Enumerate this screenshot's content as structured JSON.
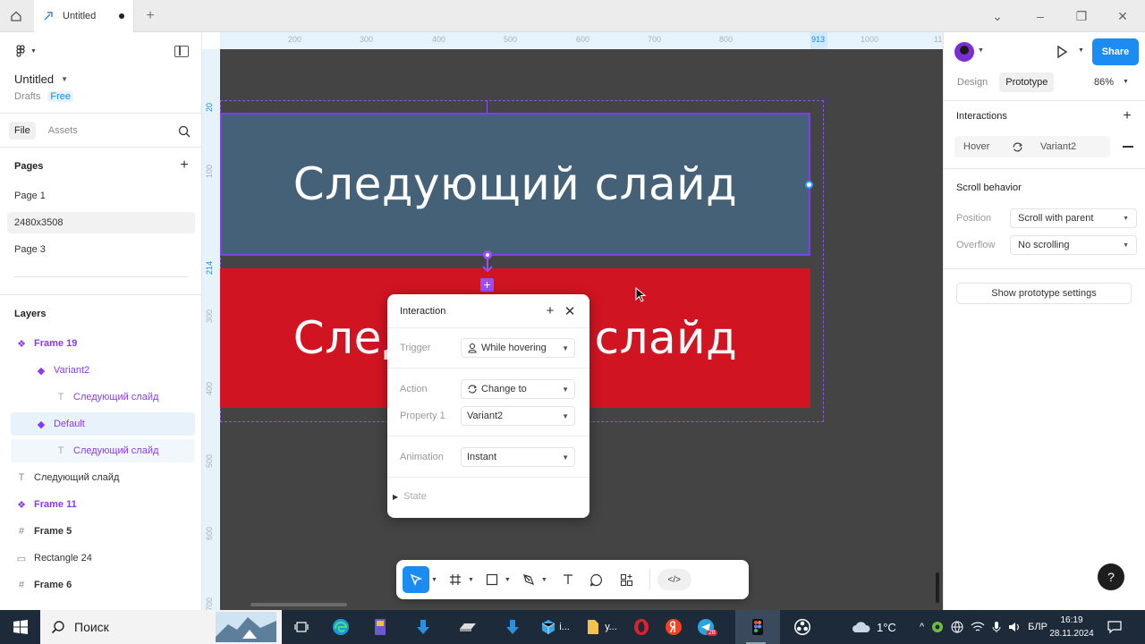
{
  "browser": {
    "tab_title": "Untitled",
    "new_tab_symbol": "+"
  },
  "left_panel": {
    "file_name": "Untitled",
    "location": "Drafts",
    "plan_badge": "Free",
    "tabs": [
      "File",
      "Assets"
    ],
    "pages_title": "Pages",
    "pages": [
      "Page 1",
      "2480x3508",
      "Page 3"
    ],
    "layers_title": "Layers",
    "layers": [
      {
        "label": "Frame 19",
        "icon": "component-set-icon"
      },
      {
        "label": "Variant2",
        "icon": "component-icon"
      },
      {
        "label": "Следующий слайд",
        "icon": "text-icon"
      },
      {
        "label": "Default",
        "icon": "component-icon"
      },
      {
        "label": "Следующий слайд",
        "icon": "text-icon"
      },
      {
        "label": "Следующий слайд",
        "icon": "text-icon"
      },
      {
        "label": "Frame 11",
        "icon": "component-set-icon"
      },
      {
        "label": "Frame 5",
        "icon": "frame-icon"
      },
      {
        "label": "Rectangle 24",
        "icon": "rectangle-icon"
      },
      {
        "label": "Frame 6",
        "icon": "frame-icon"
      }
    ]
  },
  "canvas": {
    "ruler_top": [
      "200",
      "300",
      "400",
      "500",
      "600",
      "700",
      "800",
      "913",
      "1000",
      "11"
    ],
    "ruler_left": [
      "20",
      "100",
      "214",
      "300",
      "400",
      "500",
      "600",
      "700"
    ],
    "slide_text_top": "Следующий слайд",
    "slide_text_bottom": "Следующий слайд",
    "top_button_color": "#456178",
    "bottom_button_color": "#d01422",
    "selection_color": "#7b3ff2"
  },
  "interaction_popup": {
    "title": "Interaction",
    "trigger_label": "Trigger",
    "trigger_value": "While hovering",
    "action_label": "Action",
    "action_value": "Change to",
    "property_label": "Property 1",
    "property_value": "Variant2",
    "animation_label": "Animation",
    "animation_value": "Instant",
    "state_label": "State"
  },
  "right_panel": {
    "share_label": "Share",
    "tabs": [
      "Design",
      "Prototype"
    ],
    "zoom": "86%",
    "interactions_title": "Interactions",
    "interaction_trigger": "Hover",
    "interaction_target": "Variant2",
    "scroll_title": "Scroll behavior",
    "position_label": "Position",
    "position_value": "Scroll with parent",
    "overflow_label": "Overflow",
    "overflow_value": "No scrolling",
    "prototype_settings_label": "Show prototype settings",
    "accent_color": "#1b8cf2"
  },
  "taskbar": {
    "search_placeholder": "Поиск",
    "app_label_i": "i...",
    "app_label_y": "у...",
    "telegram_badge": "28",
    "weather": "1°C",
    "language": "БЛР",
    "time": "16:19",
    "date": "28.11.2024"
  }
}
